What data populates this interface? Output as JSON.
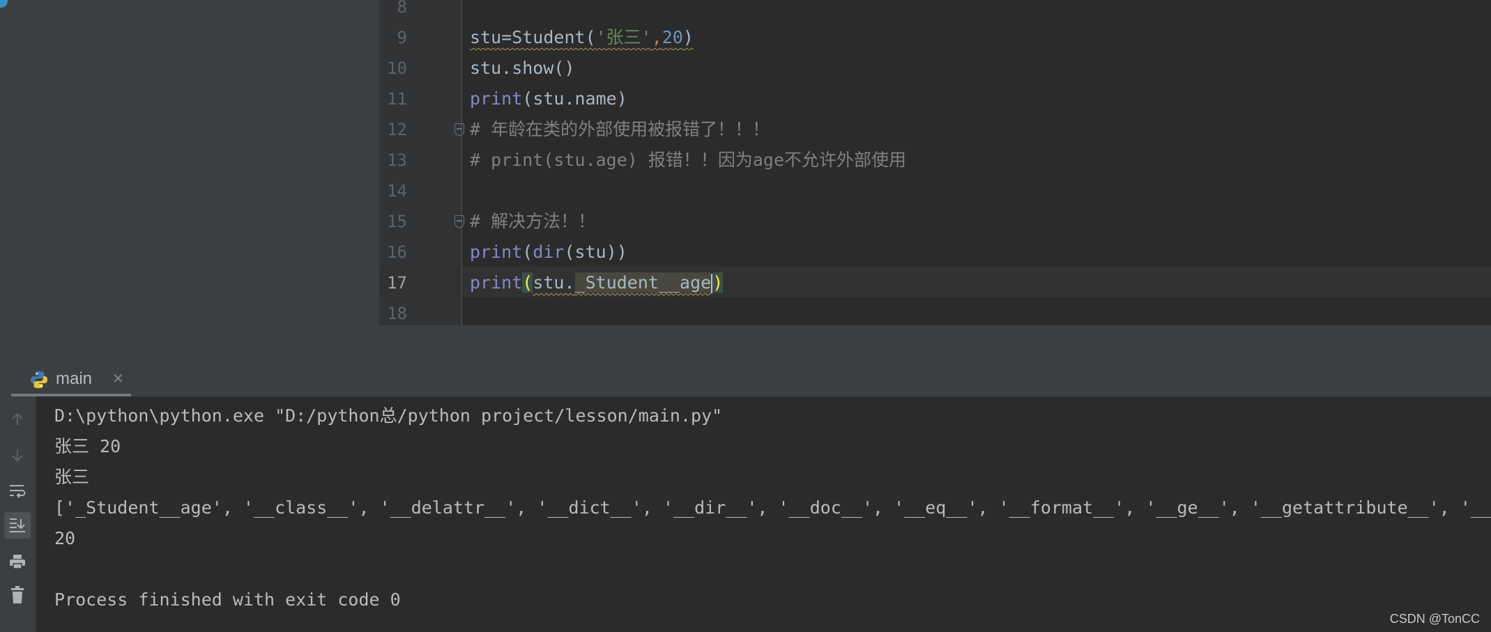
{
  "editor": {
    "lines": [
      {
        "num": "8",
        "tokens": []
      },
      {
        "num": "9",
        "tokens": [
          {
            "t": "stu=Student(",
            "c": "plain",
            "sq": true
          },
          {
            "t": "'张三'",
            "c": "str",
            "sq": true
          },
          {
            "t": ",",
            "c": "comma",
            "sq": true
          },
          {
            "t": "20",
            "c": "num",
            "sq": true
          },
          {
            "t": ")",
            "c": "plain",
            "sq": true
          }
        ]
      },
      {
        "num": "10",
        "tokens": [
          {
            "t": "stu.show()",
            "c": "plain"
          }
        ]
      },
      {
        "num": "11",
        "tokens": [
          {
            "t": "print",
            "c": "builtin"
          },
          {
            "t": "(stu.name)",
            "c": "plain"
          }
        ]
      },
      {
        "num": "12",
        "fold": true,
        "tokens": [
          {
            "t": "# 年龄在类的外部使用被报错了！！！",
            "c": "comment"
          }
        ]
      },
      {
        "num": "13",
        "tokens": [
          {
            "t": "# print(stu.age) 报错！！因为age不允许外部使用",
            "c": "comment"
          }
        ]
      },
      {
        "num": "14",
        "tokens": []
      },
      {
        "num": "15",
        "fold": true,
        "tokens": [
          {
            "t": "# 解决方法！！",
            "c": "comment"
          }
        ]
      },
      {
        "num": "16",
        "tokens": [
          {
            "t": "print",
            "c": "builtin"
          },
          {
            "t": "(",
            "c": "plain"
          },
          {
            "t": "dir",
            "c": "builtin"
          },
          {
            "t": "(stu))",
            "c": "plain"
          }
        ]
      },
      {
        "num": "17",
        "current": true,
        "tokens": [
          {
            "t": "print",
            "c": "builtin"
          },
          {
            "t": "(",
            "c": "paren"
          },
          {
            "t": "stu.",
            "c": "plain",
            "sq": true
          },
          {
            "t": "_Student__age",
            "c": "attrhl",
            "sq": true
          },
          {
            "t": "|",
            "c": "caret"
          },
          {
            "t": ")",
            "c": "paren"
          }
        ]
      },
      {
        "num": "18",
        "tokens": []
      }
    ]
  },
  "run_panel": {
    "tab_label": "main",
    "tab_close": "✕",
    "icons": [
      "arrow-up-icon",
      "arrow-down-icon",
      "soft-wrap-icon",
      "scroll-to-end-icon",
      "print-icon",
      "trash-icon"
    ],
    "output": [
      "D:\\python\\python.exe \"D:/python总/python project/lesson/main.py\"",
      "张三 20",
      "张三",
      "['_Student__age', '__class__', '__delattr__', '__dict__', '__dir__', '__doc__', '__eq__', '__format__', '__ge__', '__getattribute__', '__gt__', '__hash__', '__init__']",
      "20",
      "",
      "Process finished with exit code 0"
    ]
  },
  "watermark": "CSDN @TonCC",
  "colors": {
    "background": "#2b2b2b",
    "panel": "#3c3f41",
    "builtin": "#8888c6",
    "string": "#6a8759",
    "number": "#6897bb",
    "comment": "#808080",
    "text": "#a9b7c6"
  }
}
